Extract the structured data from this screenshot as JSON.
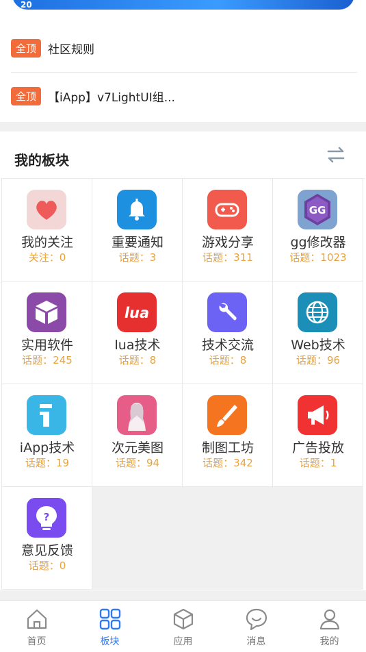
{
  "status": {
    "time": "20"
  },
  "pinned": [
    {
      "badge": "全顶",
      "title": "社区规则"
    },
    {
      "badge": "全顶",
      "title": "【iApp】v7LightUI组..."
    }
  ],
  "boards_section": {
    "title": "我的板块"
  },
  "boards": [
    {
      "name": "我的关注",
      "stat": "关注：0",
      "icon": "heart-icon"
    },
    {
      "name": "重要通知",
      "stat": "话题：3",
      "icon": "bell-icon"
    },
    {
      "name": "游戏分享",
      "stat": "话题：311",
      "icon": "gamepad-icon"
    },
    {
      "name": "gg修改器",
      "stat": "话题：1023",
      "icon": "gg-icon"
    },
    {
      "name": "实用软件",
      "stat": "话题：245",
      "icon": "box-icon"
    },
    {
      "name": "lua技术",
      "stat": "话题：8",
      "icon": "lua-icon",
      "icon_text": "lua"
    },
    {
      "name": "技术交流",
      "stat": "话题：8",
      "icon": "wrench-icon"
    },
    {
      "name": "Web技术",
      "stat": "话题：96",
      "icon": "globe-icon"
    },
    {
      "name": "iApp技术",
      "stat": "话题：19",
      "icon": "iapp-icon"
    },
    {
      "name": "次元美图",
      "stat": "话题：94",
      "icon": "anime-icon"
    },
    {
      "name": "制图工坊",
      "stat": "话题：342",
      "icon": "brush-icon"
    },
    {
      "name": "广告投放",
      "stat": "话题：1",
      "icon": "megaphone-icon"
    },
    {
      "name": "意见反馈",
      "stat": "话题：0",
      "icon": "feedback-icon"
    }
  ],
  "tabs": [
    {
      "label": "首页",
      "icon": "home-icon"
    },
    {
      "label": "板块",
      "icon": "grid-icon",
      "active": true
    },
    {
      "label": "应用",
      "icon": "cube-icon"
    },
    {
      "label": "消息",
      "icon": "chat-icon"
    },
    {
      "label": "我的",
      "icon": "user-icon"
    }
  ],
  "colors": {
    "accent": "#2f7bf5",
    "badge": "#f26b3a",
    "stat": "#e8a23e"
  }
}
